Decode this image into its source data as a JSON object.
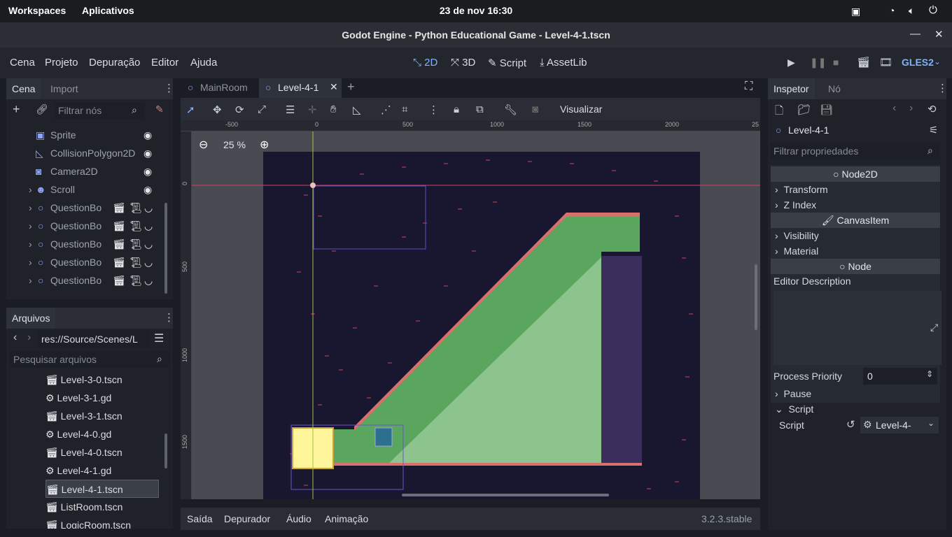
{
  "system": {
    "workspaces": "Workspaces",
    "apps": "Aplicativos",
    "clock": "23 de nov  16:30"
  },
  "window": {
    "title": "Godot Engine - Python Educational Game - Level-4-1.tscn"
  },
  "menu": {
    "items": [
      "Cena",
      "Projeto",
      "Depuração",
      "Editor",
      "Ajuda"
    ]
  },
  "workspaces": {
    "w2d": "2D",
    "w3d": "3D",
    "script": "Script",
    "assetlib": "AssetLib"
  },
  "renderer": "GLES2",
  "scene_dock": {
    "tab_scene": "Cena",
    "tab_import": "Import",
    "filter_placeholder": "Filtrar nós",
    "nodes": [
      {
        "label": "Sprite"
      },
      {
        "label": "CollisionPolygon2D"
      },
      {
        "label": "Camera2D"
      },
      {
        "label": "Scroll"
      },
      {
        "label": "QuestionBo"
      },
      {
        "label": "QuestionBo"
      },
      {
        "label": "QuestionBo"
      },
      {
        "label": "QuestionBo"
      },
      {
        "label": "QuestionBo"
      }
    ]
  },
  "files_dock": {
    "title": "Arquivos",
    "path": "res://Source/Scenes/L",
    "search_placeholder": "Pesquisar arquivos",
    "files": [
      {
        "name": "Level-3-0.tscn",
        "icon": "scene-icon"
      },
      {
        "name": "Level-3-1.gd",
        "icon": "gear-icon"
      },
      {
        "name": "Level-3-1.tscn",
        "icon": "scene-icon"
      },
      {
        "name": "Level-4-0.gd",
        "icon": "gear-icon"
      },
      {
        "name": "Level-4-0.tscn",
        "icon": "scene-icon"
      },
      {
        "name": "Level-4-1.gd",
        "icon": "gear-icon"
      },
      {
        "name": "Level-4-1.tscn",
        "icon": "scene-icon",
        "selected": true
      },
      {
        "name": "ListRoom.tscn",
        "icon": "scene-icon"
      },
      {
        "name": "LogicRoom.tscn",
        "icon": "scene-icon"
      }
    ]
  },
  "viewport": {
    "tabs": [
      {
        "label": "MainRoom"
      },
      {
        "label": "Level-4-1"
      }
    ],
    "view_menu": "Visualizar",
    "zoom": "25 %",
    "ruler_h": [
      "-500",
      "0",
      "500",
      "1000",
      "1500",
      "2000",
      "25"
    ],
    "ruler_v": [
      "0",
      "500",
      "1000",
      "1500"
    ]
  },
  "bottom": {
    "tabs": [
      "Saída",
      "Depurador",
      "Áudio",
      "Animação"
    ],
    "version": "3.2.3.stable"
  },
  "inspector": {
    "tab_inspector": "Inspetor",
    "tab_node": "Nó",
    "node_name": "Level-4-1",
    "filter_placeholder": "Filtrar propriedades",
    "section_node2d": "Node2D",
    "transform": "Transform",
    "zindex": "Z Index",
    "section_canvasitem": "CanvasItem",
    "visibility": "Visibility",
    "material": "Material",
    "section_node": "Node",
    "editor_description": "Editor Description",
    "process_priority_label": "Process Priority",
    "process_priority_value": "0",
    "pause": "Pause",
    "script_section": "Script",
    "script_label": "Script",
    "script_value": "Level-4-"
  },
  "colors": {
    "accent": "#7fb2ff",
    "background": "#1a1d24",
    "panel": "#2a2d35",
    "level_bg": "#191730",
    "grass": "#5aa65e",
    "fill": "#8dc48d",
    "wall": "#3b2d5c",
    "yellow": "#fff59a"
  }
}
